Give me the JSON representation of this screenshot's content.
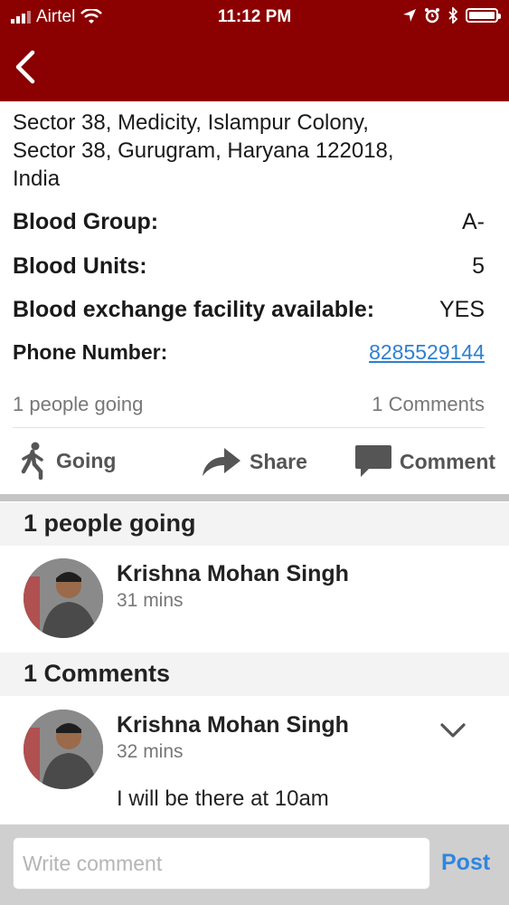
{
  "status_bar": {
    "carrier": "Airtel",
    "time": "11:12 PM"
  },
  "details": {
    "address_lines": [
      "Sector 38, Medicity, Islampur Colony,",
      "Sector 38, Gurugram, Haryana 122018,",
      "India"
    ],
    "blood_group_label": "Blood Group:",
    "blood_group_value": "A-",
    "blood_units_label": "Blood Units:",
    "blood_units_value": "5",
    "exchange_label": "Blood exchange facility available:",
    "exchange_value": "YES",
    "phone_label": "Phone Number:",
    "phone_value": "8285529144"
  },
  "meta": {
    "going_count": "1 people going",
    "comments_count": "1 Comments"
  },
  "actions": {
    "going": "Going",
    "share": "Share",
    "comment": "Comment"
  },
  "going_section": {
    "title": "1 people going",
    "user": {
      "name": "Krishna Mohan Singh",
      "time": "31 mins"
    }
  },
  "comments_section": {
    "title": "1 Comments",
    "comment": {
      "name": "Krishna Mohan Singh",
      "time": "32 mins",
      "text": "I will be there at 10am"
    }
  },
  "composer": {
    "placeholder": "Write comment",
    "post_label": "Post"
  },
  "colors": {
    "header": "#8b0000",
    "link": "#2f7fd0",
    "post": "#2f86e0"
  }
}
